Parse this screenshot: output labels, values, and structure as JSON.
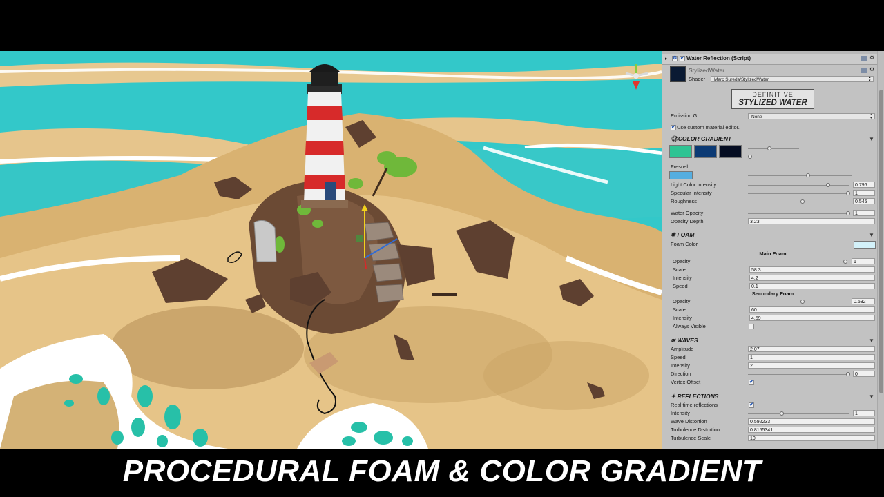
{
  "caption": "PROCEDURAL FOAM & COLOR GRADIENT",
  "inspector": {
    "component_title": "Water Reflection (Script)",
    "material_name": "StylizedWater",
    "shader_label": "Shader",
    "shader_value": "Marc Sureda/StylizedWater",
    "logo_line1": "DEFINITIVE",
    "logo_line2": "STYLIZED WATER",
    "emission_label": "Emission GI",
    "emission_value": "None",
    "custom_editor_label": "Use custom material editor.",
    "color_gradient": {
      "title": "COLOR GRADIENT",
      "swatches": [
        "#2fc493",
        "#0c3a74",
        "#050d22"
      ],
      "fresnel_label": "Fresnel",
      "fresnel_color": "#56aee0"
    },
    "params": [
      {
        "label": "Light Color Intensity",
        "value": "0.796"
      },
      {
        "label": "Specular Intensity",
        "value": "1"
      },
      {
        "label": "Roughness",
        "value": "0.545"
      },
      {
        "label": "Water Opacity",
        "value": "1"
      },
      {
        "label": "Opacity Depth",
        "value": "3.23"
      }
    ],
    "foam": {
      "title": "FOAM",
      "color_label": "Foam Color",
      "color": "#d3f1f9",
      "main_title": "Main Foam",
      "main": [
        {
          "label": "Opacity",
          "value": "1"
        },
        {
          "label": "Scale",
          "value": "58.3"
        },
        {
          "label": "Intensity",
          "value": "4.2"
        },
        {
          "label": "Speed",
          "value": "0.1"
        }
      ],
      "secondary_title": "Secondary Foam",
      "secondary": [
        {
          "label": "Opacity",
          "value": "0.532"
        },
        {
          "label": "Scale",
          "value": "60"
        },
        {
          "label": "Intensity",
          "value": "4.59"
        },
        {
          "label": "Always Visible",
          "value": ""
        }
      ]
    },
    "waves": {
      "title": "WAVES",
      "items": [
        {
          "label": "Amplitude",
          "value": "2.07"
        },
        {
          "label": "Speed",
          "value": "1"
        },
        {
          "label": "Intensity",
          "value": "2"
        },
        {
          "label": "Direction",
          "value": "0"
        },
        {
          "label": "Vertex Offset",
          "value": ""
        }
      ]
    },
    "reflections": {
      "title": "REFLECTIONS",
      "items": [
        {
          "label": "Real time reflections",
          "value": ""
        },
        {
          "label": "Intensity",
          "value": "1"
        },
        {
          "label": "Wave Distortion",
          "value": "0.592233"
        },
        {
          "label": "Turbulence Distortion",
          "value": "0.8155341"
        },
        {
          "label": "Turbulence Scale",
          "value": "10"
        }
      ]
    }
  }
}
